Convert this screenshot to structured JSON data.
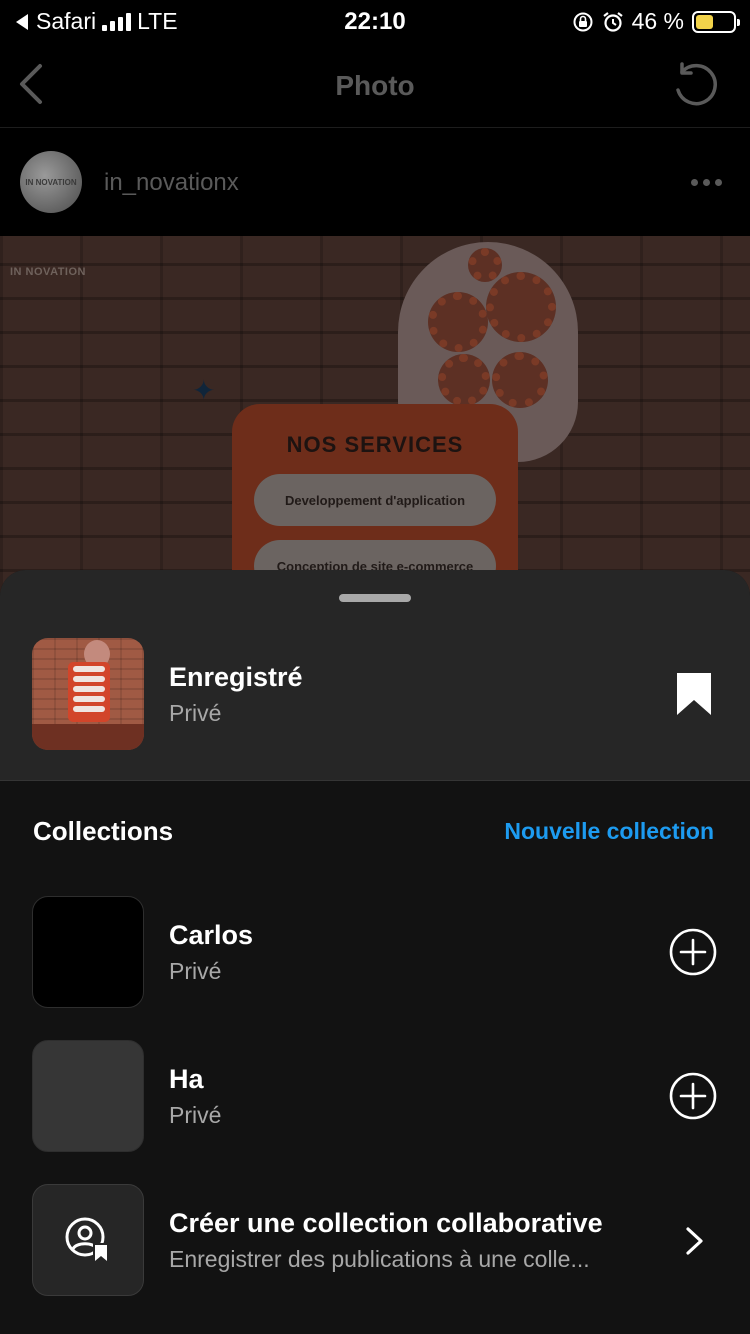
{
  "status_bar": {
    "back_app": "Safari",
    "network": "LTE",
    "time": "22:10",
    "battery_percent": "46 %",
    "battery_level": 0.46
  },
  "nav": {
    "title": "Photo"
  },
  "post": {
    "username": "in_novationx",
    "avatar_logo_text": "IN NOVATION",
    "image": {
      "logo_text": "IN NOVATION",
      "services_title": "NOS SERVICES",
      "services": [
        "Developpement d'application",
        "Conception de site e-commerce"
      ]
    }
  },
  "sheet": {
    "saved": {
      "title": "Enregistré",
      "subtitle": "Privé"
    },
    "collections_heading": "Collections",
    "new_collection_label": "Nouvelle collection",
    "collections": [
      {
        "title": "Carlos",
        "subtitle": "Privé"
      },
      {
        "title": "Ha",
        "subtitle": "Privé"
      }
    ],
    "collaborative": {
      "title": "Créer une collection collaborative",
      "subtitle": "Enregistrer des publications à une colle..."
    }
  },
  "colors": {
    "accent": "#1d9bf0",
    "sheet_bg": "#121212",
    "sheet_top_bg": "#262626",
    "battery": "#f2d34a"
  },
  "icons": [
    "back-arrow-icon",
    "signal-icon",
    "rotation-lock-icon",
    "alarm-icon",
    "battery-icon",
    "chevron-left-icon",
    "refresh-icon",
    "more-icon",
    "bookmark-icon",
    "add-circle-icon",
    "collaborative-icon",
    "chevron-right-icon"
  ]
}
